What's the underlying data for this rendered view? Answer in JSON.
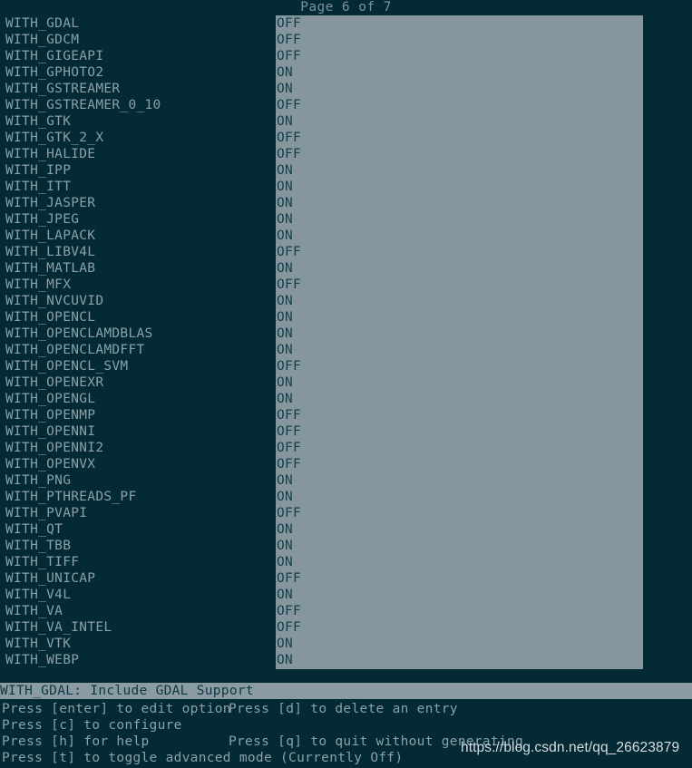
{
  "header": {
    "page_indicator": "Page 6 of 7"
  },
  "colors": {
    "background": "#032a35",
    "panel": "#85979d",
    "option_text": "#8ba1a7",
    "value_text": "#123f4e",
    "status_bar_bg": "#8a9ca1",
    "status_bar_text": "#0d3644",
    "watermark_text": "#e9eef0"
  },
  "options": [
    {
      "name": "WITH_GDAL",
      "value": "OFF"
    },
    {
      "name": "WITH_GDCM",
      "value": "OFF"
    },
    {
      "name": "WITH_GIGEAPI",
      "value": "OFF"
    },
    {
      "name": "WITH_GPHOTO2",
      "value": "ON"
    },
    {
      "name": "WITH_GSTREAMER",
      "value": "ON"
    },
    {
      "name": "WITH_GSTREAMER_0_10",
      "value": "OFF"
    },
    {
      "name": "WITH_GTK",
      "value": "ON"
    },
    {
      "name": "WITH_GTK_2_X",
      "value": "OFF"
    },
    {
      "name": "WITH_HALIDE",
      "value": "OFF"
    },
    {
      "name": "WITH_IPP",
      "value": "ON"
    },
    {
      "name": "WITH_ITT",
      "value": "ON"
    },
    {
      "name": "WITH_JASPER",
      "value": "ON"
    },
    {
      "name": "WITH_JPEG",
      "value": "ON"
    },
    {
      "name": "WITH_LAPACK",
      "value": "ON"
    },
    {
      "name": "WITH_LIBV4L",
      "value": "OFF"
    },
    {
      "name": "WITH_MATLAB",
      "value": "ON"
    },
    {
      "name": "WITH_MFX",
      "value": "OFF"
    },
    {
      "name": "WITH_NVCUVID",
      "value": "ON"
    },
    {
      "name": "WITH_OPENCL",
      "value": "ON"
    },
    {
      "name": "WITH_OPENCLAMDBLAS",
      "value": "ON"
    },
    {
      "name": "WITH_OPENCLAMDFFT",
      "value": "ON"
    },
    {
      "name": "WITH_OPENCL_SVM",
      "value": "OFF"
    },
    {
      "name": "WITH_OPENEXR",
      "value": "ON"
    },
    {
      "name": "WITH_OPENGL",
      "value": "ON"
    },
    {
      "name": "WITH_OPENMP",
      "value": "OFF"
    },
    {
      "name": "WITH_OPENNI",
      "value": "OFF"
    },
    {
      "name": "WITH_OPENNI2",
      "value": "OFF"
    },
    {
      "name": "WITH_OPENVX",
      "value": "OFF"
    },
    {
      "name": "WITH_PNG",
      "value": "ON"
    },
    {
      "name": "WITH_PTHREADS_PF",
      "value": "ON"
    },
    {
      "name": "WITH_PVAPI",
      "value": "OFF"
    },
    {
      "name": "WITH_QT",
      "value": "ON"
    },
    {
      "name": "WITH_TBB",
      "value": "ON"
    },
    {
      "name": "WITH_TIFF",
      "value": "ON"
    },
    {
      "name": "WITH_UNICAP",
      "value": "OFF"
    },
    {
      "name": "WITH_V4L",
      "value": "ON"
    },
    {
      "name": "WITH_VA",
      "value": "OFF"
    },
    {
      "name": "WITH_VA_INTEL",
      "value": "OFF"
    },
    {
      "name": "WITH_VTK",
      "value": "ON"
    },
    {
      "name": "WITH_WEBP",
      "value": "ON"
    }
  ],
  "status_bar": {
    "description": "WITH_GDAL: Include GDAL Support"
  },
  "help": {
    "lines": [
      {
        "left": "Press [enter] to edit option",
        "right": "Press [d] to delete an entry"
      },
      {
        "left": "Press [c] to configure",
        "right": ""
      },
      {
        "left": "Press [h] for help",
        "right": "Press [q] to quit without generating"
      },
      {
        "left": "Press [t] to toggle advanced mode (Currently Off)",
        "right": ""
      }
    ]
  },
  "watermark": {
    "text": "https://blog.csdn.net/qq_26623879"
  }
}
